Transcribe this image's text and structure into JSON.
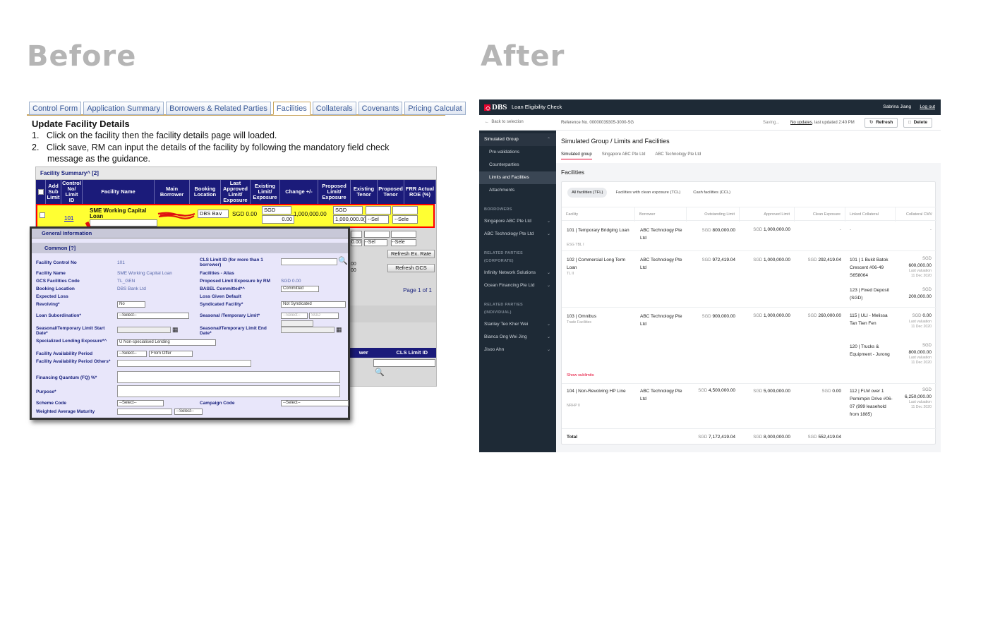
{
  "headings": {
    "before": "Before",
    "after": "After"
  },
  "old": {
    "tabs": [
      "Control Form",
      "Application Summary",
      "Borrowers & Related Parties",
      "Facilities",
      "Collaterals",
      "Covenants",
      "Pricing Calculat"
    ],
    "title": "Update Facility Details",
    "steps": [
      "1.   Click on the facility then the facility details page will loaded.",
      "2.   Click save, RM can input the details of the facility by following the mandatory field check message as the guidance."
    ],
    "grid_title": "Facility Summary^ [2]",
    "columns": [
      "",
      "Add Sub Limit",
      "Control No/ Limit ID",
      "Facility Name",
      "Main Borrower",
      "Booking Location",
      "Last Approved Limit/ Exposure",
      "Existing Limit/ Exposure",
      "Change +/-",
      "Proposed Limit/ Exposure",
      "Existing Tenor",
      "Proposed Tenor",
      "FRR Actual ROE (%)"
    ],
    "row": {
      "control_no": "101",
      "facility_name": "SME Working Capital Loan",
      "booking": "DBS Ba∨",
      "last_approved": "SGD 0.00",
      "existing_ccy": "SGD",
      "existing_amt": "0.00",
      "change": "1,000,000.00",
      "proposed_ccy": "SGD",
      "proposed_amt": "1,000,000.0(",
      "tenor_sel": "--Sel",
      "tenor_sel2": "--Sele"
    },
    "row2": {
      "amt": "0.00",
      "sel1": "--Sel",
      "sel2": "--Sele"
    },
    "buttons": {
      "refresh_ex": "Refresh Ex. Rate",
      "refresh_gcs": "Refresh GCS"
    },
    "frag_amt": "00",
    "page": "Page 1 of 1",
    "tbl2": {
      "col1": "wer",
      "col2": "CLS Limit ID"
    },
    "popup": {
      "general": "General Information",
      "common": "Common [?]",
      "fields_left": [
        {
          "label": "Facility Control No",
          "value": "101"
        },
        {
          "label": "Facility Name",
          "value": "SME Working Capital Loan"
        },
        {
          "label": "GCS Facilities Code",
          "value": "TL_GEN"
        },
        {
          "label": "Booking Location",
          "value": "DBS Bank Ltd"
        },
        {
          "label": "Expected Loss",
          "value": ""
        },
        {
          "label": "Revolving*",
          "value": "No"
        },
        {
          "label": "Loan Subordination*",
          "value": "--Select--"
        }
      ],
      "fields_right": [
        {
          "label": "CLS Limit ID (for more than 1 borrower)",
          "value": ""
        },
        {
          "label": "Facilities - Alias",
          "value": ""
        },
        {
          "label": "Proposed Limit Exposure by RM",
          "value": "SGD 0.00"
        },
        {
          "label": "BASEL Committed*^",
          "value": "Committed"
        },
        {
          "label": "Loss Given Default",
          "value": ""
        },
        {
          "label": "Syndicated Facility*",
          "value": "Not Syndicated"
        },
        {
          "label": "Seasonal /Temporary Limit*",
          "value": "--Select--"
        }
      ],
      "seasonal_ccy": "SGD",
      "start_date": "Seasonal/Temporary Limit Start Date*",
      "end_date": "Seasonal/Temporary Limit End Date*",
      "specialized": "Specialized Lending Exposure*^",
      "specialized_val": "U Non-specialised Lending",
      "availability": "Facility Availability Period",
      "avail_sel1": "--Select--",
      "avail_sel2": "From Offer",
      "availability_others": "Facility Availability Period Others*",
      "fq": "Financing Quantum (FQ) %*",
      "purpose": "Purpose*",
      "scheme": "Scheme Code",
      "scheme_val": "--Select--",
      "campaign": "Campaign Code",
      "campaign_val": "--Select--",
      "wam": "Weighted Average Maturity",
      "wam_sel": "--Select--"
    }
  },
  "app": {
    "logo": "DBS",
    "title": "Loan Eligibility Check",
    "user": "Sabrina Jiang",
    "logout": "Log out",
    "back": "Back to selection",
    "reference": "Reference No. 00000039305-3000-SG",
    "saving": "Saving...",
    "no_updates": "No updates",
    "last_updated": ", last updated 2:40 PM",
    "refresh": "Refresh",
    "delete": "Delete",
    "sidebar": {
      "group": "Simulated Group",
      "group_items": [
        "Pre-validations",
        "Counterparties",
        "Limits and Facilities",
        "Attachments"
      ],
      "borrowers_label": "BORROWERS",
      "borrowers": [
        "Singapore ABC Pte Ltd",
        "ABC Technology Pte Ltd"
      ],
      "corporate_label": "RELATED PARTIES (CORPORATE)",
      "corporate": [
        "Infinity Network Solutions",
        "Ocean Financing Pte Ltd"
      ],
      "individual_label": "RELATED PARTIES (INDIVIDUAL)",
      "individual": [
        "Stanley Teo Kher Wei",
        "Bianca Ong Wei Jing",
        "Jisoo Ahn"
      ]
    },
    "page_title": "Simulated Group / Limits and Facilities",
    "group_tabs": [
      "Simulated group",
      "Singapore ABC Pte Ltd",
      "ABC Technology Pte Ltd"
    ],
    "section_title": "Facilities",
    "chips": [
      "All facilities (TFL)",
      "Facilities with clean exposure (TCL)",
      "Cash facilities (CCL)"
    ],
    "columns": [
      "Facility",
      "Borrower",
      "Outstanding Limit",
      "Approved Limit",
      "Clean Exposure",
      "Linked Collateral",
      "Collateral CMV"
    ],
    "ccy": "SGD",
    "rows": [
      {
        "facility": "101 | Temporary Bridging Loan",
        "code": "ESG TBL I",
        "borrower": "ABC Technology Pte Ltd",
        "outstanding": "800,000.00",
        "approved": "1,000,000.00",
        "clean": "-",
        "collateral": "-",
        "cmv": "-"
      },
      {
        "facility": "102 | Commercial Long Term Loan",
        "code": "TL II",
        "borrower": "ABC Technology Pte Ltd",
        "outstanding": "972,419.04",
        "approved": "1,000,000.00",
        "clean": "292,419.04",
        "collaterals": [
          {
            "name": "101 | 1 Bukit Batok Crescent #06-49 S658064",
            "cmv": "600,000.00",
            "note": "Last valuation",
            "date": "11 Dec 2020"
          },
          {
            "name": "123 | Fixed Deposit (SGD)",
            "cmv": "200,000.00"
          }
        ]
      },
      {
        "facility": "103 | Omnibus",
        "code": "Trade Facilities",
        "borrower": "ABC Technology Pte Ltd",
        "outstanding": "900,000.00",
        "approved": "1,000,000.00",
        "clean": "260,000.00",
        "collaterals": [
          {
            "name": "115 | ULI - Melissa Tan Tien Fen",
            "cmv": "0.00",
            "note": "Last valuation",
            "date": "11 Dec 2020"
          },
          {
            "name": "120 | Trucks & Equipment - Jurong",
            "cmv": "800,000.00",
            "note": "Last valuation",
            "date": "11 Dec 2020"
          }
        ],
        "show_sublimits": "Show sublimits"
      },
      {
        "facility": "104 | Non-Revolving HP Line",
        "code": "NRHP II",
        "borrower": "ABC Technology Pte Ltd",
        "outstanding": "4,500,000.00",
        "approved": "5,000,000.00",
        "clean": "0.00",
        "collaterals": [
          {
            "name": "112 | FLM over 1 Pemimpin Drive #06-07 (999 leasehold from 1885)",
            "cmv": "6,250,000.00",
            "note": "Last valuation",
            "date": "11 Dec 2020"
          }
        ]
      }
    ],
    "total": {
      "label": "Total",
      "outstanding": "7,172,419.04",
      "approved": "8,000,000.00",
      "clean": "552,419.04"
    }
  }
}
